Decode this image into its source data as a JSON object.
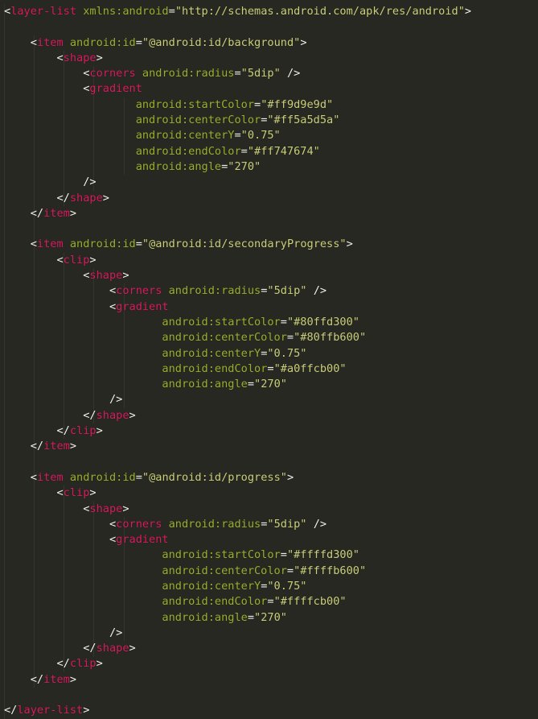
{
  "editor": {
    "language": "xml",
    "file_kind": "android-drawable-layer-list",
    "background_color": "#272822",
    "colors": {
      "punctuation": "#f2f2ea",
      "tag_name": "#d81b60",
      "attribute_name": "#9aae2e",
      "attribute_value": "#cbcf7a",
      "indent_guide": "#34352e"
    }
  },
  "code": {
    "lines": [
      {
        "n": 1,
        "indent": 0,
        "text": "<layer-list xmlns:android=\"http://schemas.android.com/apk/res/android\">"
      },
      {
        "n": 2,
        "indent": 0,
        "text": ""
      },
      {
        "n": 3,
        "indent": 4,
        "text": "<item android:id=\"@android:id/background\">"
      },
      {
        "n": 4,
        "indent": 8,
        "text": "<shape>"
      },
      {
        "n": 5,
        "indent": 12,
        "text": "<corners android:radius=\"5dip\" />"
      },
      {
        "n": 6,
        "indent": 12,
        "text": "<gradient"
      },
      {
        "n": 7,
        "indent": 20,
        "text": "android:startColor=\"#ff9d9e9d\""
      },
      {
        "n": 8,
        "indent": 20,
        "text": "android:centerColor=\"#ff5a5d5a\""
      },
      {
        "n": 9,
        "indent": 20,
        "text": "android:centerY=\"0.75\""
      },
      {
        "n": 10,
        "indent": 20,
        "text": "android:endColor=\"#ff747674\""
      },
      {
        "n": 11,
        "indent": 20,
        "text": "android:angle=\"270\""
      },
      {
        "n": 12,
        "indent": 12,
        "text": "/>"
      },
      {
        "n": 13,
        "indent": 8,
        "text": "</shape>"
      },
      {
        "n": 14,
        "indent": 4,
        "text": "</item>"
      },
      {
        "n": 15,
        "indent": 0,
        "text": ""
      },
      {
        "n": 16,
        "indent": 4,
        "text": "<item android:id=\"@android:id/secondaryProgress\">"
      },
      {
        "n": 17,
        "indent": 8,
        "text": "<clip>"
      },
      {
        "n": 18,
        "indent": 12,
        "text": "<shape>"
      },
      {
        "n": 19,
        "indent": 16,
        "text": "<corners android:radius=\"5dip\" />"
      },
      {
        "n": 20,
        "indent": 16,
        "text": "<gradient"
      },
      {
        "n": 21,
        "indent": 24,
        "text": "android:startColor=\"#80ffd300\""
      },
      {
        "n": 22,
        "indent": 24,
        "text": "android:centerColor=\"#80ffb600\""
      },
      {
        "n": 23,
        "indent": 24,
        "text": "android:centerY=\"0.75\""
      },
      {
        "n": 24,
        "indent": 24,
        "text": "android:endColor=\"#a0ffcb00\""
      },
      {
        "n": 25,
        "indent": 24,
        "text": "android:angle=\"270\""
      },
      {
        "n": 26,
        "indent": 16,
        "text": "/>"
      },
      {
        "n": 27,
        "indent": 12,
        "text": "</shape>"
      },
      {
        "n": 28,
        "indent": 8,
        "text": "</clip>"
      },
      {
        "n": 29,
        "indent": 4,
        "text": "</item>"
      },
      {
        "n": 30,
        "indent": 0,
        "text": ""
      },
      {
        "n": 31,
        "indent": 4,
        "text": "<item android:id=\"@android:id/progress\">"
      },
      {
        "n": 32,
        "indent": 8,
        "text": "<clip>"
      },
      {
        "n": 33,
        "indent": 12,
        "text": "<shape>"
      },
      {
        "n": 34,
        "indent": 16,
        "text": "<corners android:radius=\"5dip\" />"
      },
      {
        "n": 35,
        "indent": 16,
        "text": "<gradient"
      },
      {
        "n": 36,
        "indent": 24,
        "text": "android:startColor=\"#ffffd300\""
      },
      {
        "n": 37,
        "indent": 24,
        "text": "android:centerColor=\"#ffffb600\""
      },
      {
        "n": 38,
        "indent": 24,
        "text": "android:centerY=\"0.75\""
      },
      {
        "n": 39,
        "indent": 24,
        "text": "android:endColor=\"#ffffcb00\""
      },
      {
        "n": 40,
        "indent": 24,
        "text": "android:angle=\"270\""
      },
      {
        "n": 41,
        "indent": 16,
        "text": "/>"
      },
      {
        "n": 42,
        "indent": 12,
        "text": "</shape>"
      },
      {
        "n": 43,
        "indent": 8,
        "text": "</clip>"
      },
      {
        "n": 44,
        "indent": 4,
        "text": "</item>"
      },
      {
        "n": 45,
        "indent": 0,
        "text": ""
      },
      {
        "n": 46,
        "indent": 0,
        "text": "</layer-list>"
      }
    ],
    "indent_guide_columns": [
      0,
      4,
      8,
      12,
      16
    ]
  }
}
